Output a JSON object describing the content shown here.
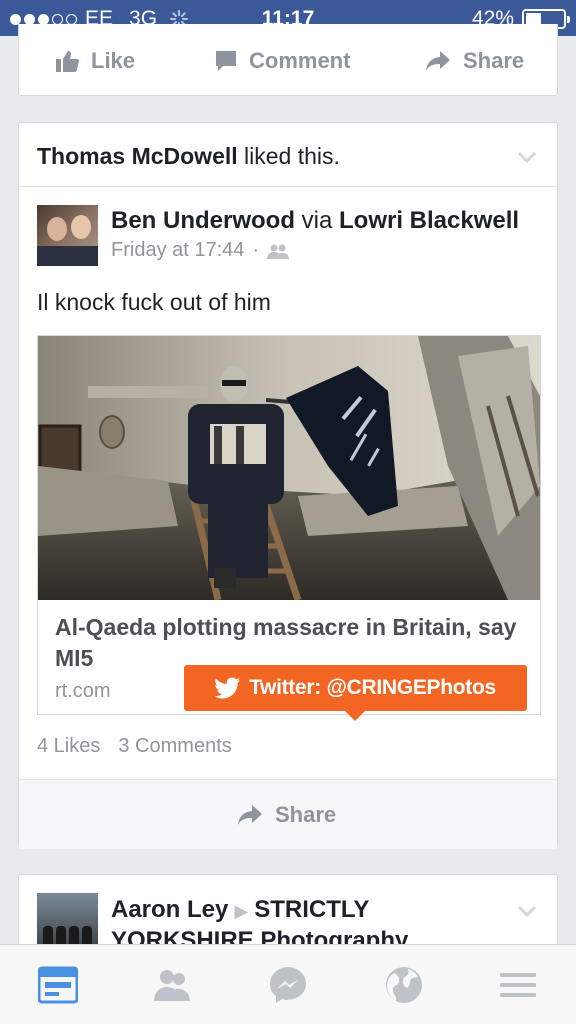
{
  "status_bar": {
    "carrier": "EE",
    "network": "3G",
    "time": "11:17",
    "battery": "42%",
    "battery_level": 0.42,
    "signal_bars_filled": 3,
    "signal_bars_total": 5
  },
  "top_actions": {
    "like": "Like",
    "comment": "Comment",
    "share": "Share"
  },
  "story": {
    "header_name": "Thomas McDowell",
    "header_suffix": " liked this.",
    "author": "Ben Underwood",
    "via_word": " via ",
    "via_name": "Lowri Blackwell",
    "time": "Friday at 17:44",
    "separator": "·",
    "text": "Il knock fuck out of him",
    "link": {
      "title": "Al-Qaeda plotting massacre in Britain, say MI5",
      "domain": "rt.com"
    },
    "likes": "4 Likes",
    "comments": "3 Comments",
    "share": "Share"
  },
  "watermark": {
    "text": "Twitter: @CRINGEPhotos"
  },
  "next_story": {
    "author": "Aaron Ley",
    "arrow": "▶",
    "target_line1": "STRICTLY",
    "target_line2": "YORKSHIRE Photography"
  },
  "tab_bar": {
    "icons": [
      "news-feed-icon",
      "friends-icon",
      "messenger-icon",
      "globe-icon",
      "menu-icon"
    ],
    "active_color": "#4a90e2",
    "inactive_color": "#bec3c9"
  },
  "colors": {
    "brand": "#3b5998",
    "watermark": "#f26522",
    "secondary_text": "#90949c"
  }
}
